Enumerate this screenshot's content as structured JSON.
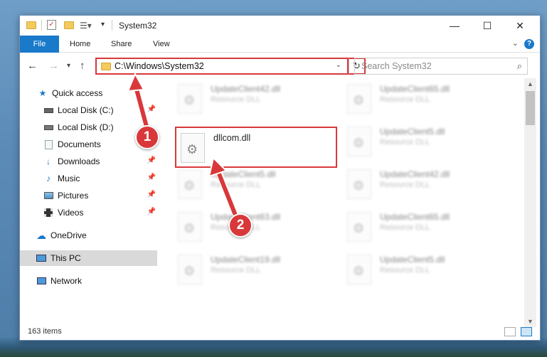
{
  "window": {
    "title": "System32"
  },
  "ribbon": {
    "tabs": [
      "File",
      "Home",
      "Share",
      "View"
    ]
  },
  "address_bar": {
    "path": "C:\\Windows\\System32"
  },
  "search": {
    "placeholder": "Search System32"
  },
  "sidebar": {
    "items": [
      {
        "label": "Quick access",
        "icon": "star-icon"
      },
      {
        "label": "Local Disk (C:)",
        "icon": "drive-icon"
      },
      {
        "label": "Local Disk (D:)",
        "icon": "drive-icon"
      },
      {
        "label": "Documents",
        "icon": "documents-icon"
      },
      {
        "label": "Downloads",
        "icon": "download-icon"
      },
      {
        "label": "Music",
        "icon": "music-icon"
      },
      {
        "label": "Pictures",
        "icon": "pictures-icon"
      },
      {
        "label": "Videos",
        "icon": "videos-icon"
      },
      {
        "label": "OneDrive",
        "icon": "cloud-icon"
      },
      {
        "label": "This PC",
        "icon": "computer-icon",
        "selected": true
      },
      {
        "label": "Network",
        "icon": "network-icon"
      }
    ]
  },
  "files": [
    {
      "name": "UpdateClient42.dll",
      "desc": "Resource DLL"
    },
    {
      "name": "UpdateClient65.dll",
      "desc": "Resource DLL"
    },
    {
      "name": "dllcom.dll",
      "desc": "",
      "highlighted": true
    },
    {
      "name": "UpdateClient5.dll",
      "desc": "Resource DLL"
    },
    {
      "name": "UpdateClient5.dll",
      "desc": "Resource DLL"
    },
    {
      "name": "UpdateClient42.dll",
      "desc": "Resource DLL"
    },
    {
      "name": "UpdateClient63.dll",
      "desc": "Resource DLL"
    },
    {
      "name": "UpdateClient65.dll",
      "desc": "Resource DLL"
    },
    {
      "name": "UpdateClient19.dll",
      "desc": "Resource DLL"
    },
    {
      "name": "UpdateClient5.dll",
      "desc": "Resource DLL"
    }
  ],
  "status": {
    "item_count": "163 items"
  },
  "callouts": [
    "1",
    "2"
  ],
  "colors": {
    "accent": "#1979ca",
    "highlight": "#d9383a"
  }
}
